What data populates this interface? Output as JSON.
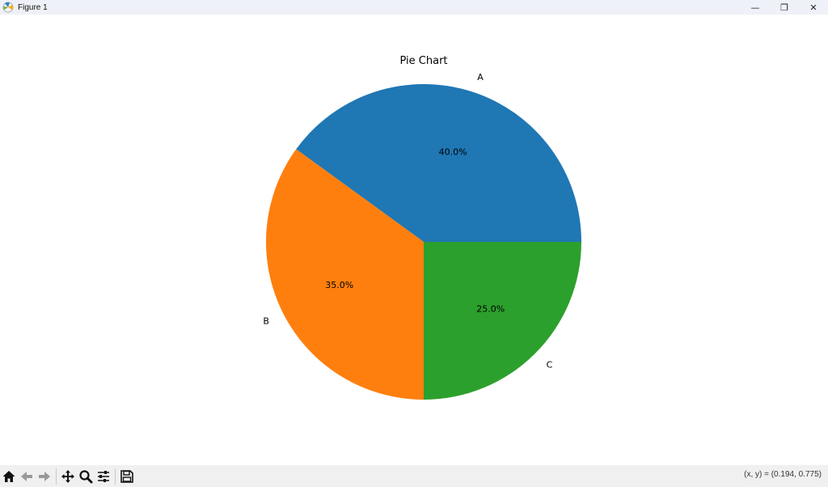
{
  "window": {
    "title": "Figure 1",
    "controls": {
      "minimize": "—",
      "restore": "❐",
      "close": "✕"
    }
  },
  "toolbar": {
    "buttons": [
      {
        "name": "home-icon"
      },
      {
        "name": "back-arrow-icon"
      },
      {
        "name": "forward-arrow-icon"
      },
      {
        "name": "pan-icon"
      },
      {
        "name": "zoom-icon"
      },
      {
        "name": "configure-subplots-icon"
      },
      {
        "name": "save-icon"
      }
    ]
  },
  "status": {
    "coords": "(x, y) = (0.194, 0.775)"
  },
  "chart_data": {
    "type": "pie",
    "title": "Pie Chart",
    "labels": [
      "A",
      "B",
      "C"
    ],
    "values": [
      40,
      35,
      25
    ],
    "autopct": [
      "40.0%",
      "35.0%",
      "25.0%"
    ],
    "colors": [
      "#1f77b4",
      "#ff7f0e",
      "#2ca02c"
    ]
  }
}
